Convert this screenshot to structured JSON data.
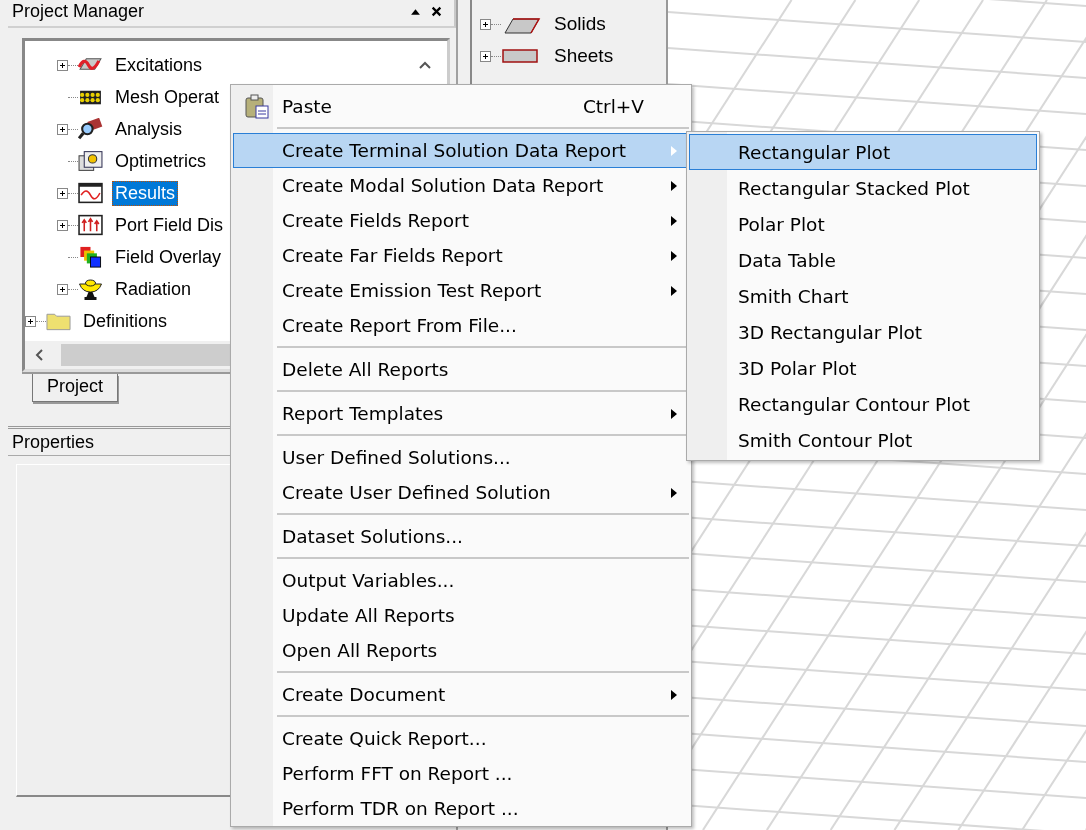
{
  "project_manager": {
    "title": "Project Manager",
    "tree": [
      {
        "children": [
          {
            "label": "Excitations",
            "kind": "excitations",
            "expandable": true,
            "selected": false
          },
          {
            "label": "Mesh Operat",
            "kind": "mesh",
            "expandable": false,
            "selected": false
          },
          {
            "label": "Analysis",
            "kind": "analysis",
            "expandable": true,
            "selected": false
          },
          {
            "label": "Optimetrics",
            "kind": "optimetrics",
            "expandable": false,
            "selected": false
          },
          {
            "label": "Results",
            "kind": "results",
            "expandable": true,
            "selected": true
          },
          {
            "label": "Port Field Dis",
            "kind": "portfield",
            "expandable": true,
            "selected": false
          },
          {
            "label": "Field Overlay",
            "kind": "overlay",
            "expandable": false,
            "selected": false
          },
          {
            "label": "Radiation",
            "kind": "radiation",
            "expandable": true,
            "selected": false
          }
        ]
      },
      {
        "label": "Definitions",
        "kind": "folder",
        "expandable": true,
        "selected": false
      }
    ],
    "tabs": [
      {
        "label": "Project",
        "selected": true
      }
    ]
  },
  "properties": {
    "title": "Properties"
  },
  "model_tree": [
    {
      "label": "Solids",
      "kind": "solids",
      "expandable": true
    },
    {
      "label": "Sheets",
      "kind": "sheets",
      "expandable": true
    }
  ],
  "context_menu": {
    "items": [
      {
        "kind": "command",
        "label": "Paste",
        "shortcut": "Ctrl+V",
        "has_icon": true,
        "has_submenu": false,
        "selected": false
      },
      {
        "kind": "separator"
      },
      {
        "kind": "command",
        "label": "Create Terminal Solution Data Report",
        "has_submenu": true,
        "selected": true
      },
      {
        "kind": "command",
        "label": "Create Modal Solution Data Report",
        "has_submenu": true,
        "selected": false
      },
      {
        "kind": "command",
        "label": "Create Fields Report",
        "has_submenu": true,
        "selected": false
      },
      {
        "kind": "command",
        "label": "Create Far Fields Report",
        "has_submenu": true,
        "selected": false
      },
      {
        "kind": "command",
        "label": "Create Emission Test Report",
        "has_submenu": true,
        "selected": false
      },
      {
        "kind": "command",
        "label": "Create Report From File...",
        "has_submenu": false,
        "selected": false
      },
      {
        "kind": "separator"
      },
      {
        "kind": "command",
        "label": "Delete All Reports",
        "has_submenu": false,
        "selected": false
      },
      {
        "kind": "separator"
      },
      {
        "kind": "command",
        "label": "Report Templates",
        "has_submenu": true,
        "selected": false
      },
      {
        "kind": "separator"
      },
      {
        "kind": "command",
        "label": "User Defined Solutions...",
        "has_submenu": false,
        "selected": false
      },
      {
        "kind": "command",
        "label": "Create User Defined Solution",
        "has_submenu": true,
        "selected": false
      },
      {
        "kind": "separator"
      },
      {
        "kind": "command",
        "label": "Dataset Solutions...",
        "has_submenu": false,
        "selected": false
      },
      {
        "kind": "separator"
      },
      {
        "kind": "command",
        "label": "Output Variables...",
        "has_submenu": false,
        "selected": false
      },
      {
        "kind": "command",
        "label": "Update All Reports",
        "has_submenu": false,
        "selected": false
      },
      {
        "kind": "command",
        "label": "Open All Reports",
        "has_submenu": false,
        "selected": false
      },
      {
        "kind": "separator"
      },
      {
        "kind": "command",
        "label": "Create Document",
        "has_submenu": true,
        "selected": false
      },
      {
        "kind": "separator"
      },
      {
        "kind": "command",
        "label": "Create Quick Report...",
        "has_submenu": false,
        "selected": false
      },
      {
        "kind": "command",
        "label": "Perform FFT on Report ...",
        "has_submenu": false,
        "selected": false
      },
      {
        "kind": "command",
        "label": "Perform TDR on Report ...",
        "has_submenu": false,
        "selected": false
      }
    ]
  },
  "submenu": {
    "items": [
      {
        "label": "Rectangular Plot",
        "selected": true
      },
      {
        "label": "Rectangular Stacked Plot",
        "selected": false
      },
      {
        "label": "Polar Plot",
        "selected": false
      },
      {
        "label": "Data Table",
        "selected": false
      },
      {
        "label": "Smith Chart",
        "selected": false
      },
      {
        "label": "3D Rectangular Plot",
        "selected": false
      },
      {
        "label": "3D Polar Plot",
        "selected": false
      },
      {
        "label": "Rectangular Contour Plot",
        "selected": false
      },
      {
        "label": "Smith Contour Plot",
        "selected": false
      }
    ]
  }
}
